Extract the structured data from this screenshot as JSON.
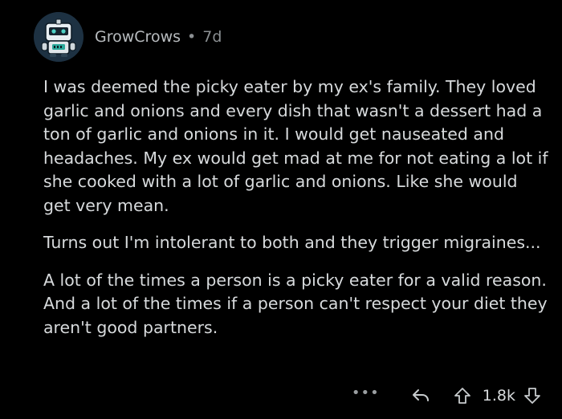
{
  "comment": {
    "username": "GrowCrows",
    "separator": "•",
    "age": "7d",
    "avatar_icon": "robot-avatar-icon",
    "paragraphs": [
      "I was deemed the picky eater by my ex's family. They loved garlic and onions and every dish that wasn't a dessert had a ton of garlic and onions in it. I would get nauseated and headaches. My ex would get mad at me for not eating a lot if she cooked with a lot of garlic and onions. Like she would get very mean.",
      "Turns out I'm intolerant to both and they trigger migraines...",
      "A lot of the times a person is a picky eater for a valid reason. And a lot of the times if a person can't respect your diet they aren't good partners."
    ],
    "actions": {
      "more_label": "•••",
      "reply_icon": "reply-arrow-icon",
      "upvote_icon": "upvote-arrow-icon",
      "score": "1.8k",
      "downvote_icon": "downvote-arrow-icon"
    }
  },
  "colors": {
    "background": "#000000",
    "text": "#d7dadc",
    "muted": "#8b8f92"
  }
}
